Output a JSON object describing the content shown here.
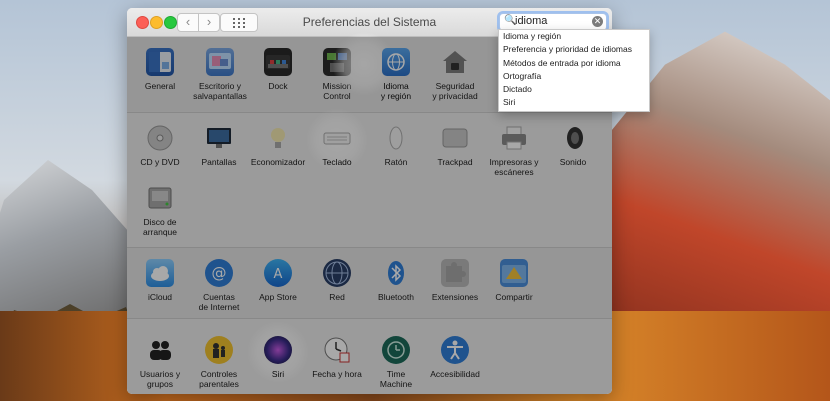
{
  "window": {
    "title": "Preferencias del Sistema",
    "back": "‹",
    "forward": "›"
  },
  "search": {
    "value": "idioma",
    "clear": "✕",
    "icon": "🔍",
    "results": [
      "Idioma y región",
      "Preferencia y prioridad de idiomas",
      "Métodos de entrada por idioma",
      "Ortografía",
      "Dictado",
      "Siri"
    ]
  },
  "prefs": {
    "general": "General",
    "escritorio": "Escritorio y\nsalvapantallas",
    "dock": "Dock",
    "mission": "Mission\nControl",
    "idioma": "Idioma\ny región",
    "seguridad": "Seguridad\ny privacidad",
    "cd": "CD y DVD",
    "pantallas": "Pantallas",
    "economizador": "Economizador",
    "teclado": "Teclado",
    "raton": "Ratón",
    "trackpad": "Trackpad",
    "impresoras": "Impresoras y\nescáneres",
    "sonido": "Sonido",
    "disco": "Disco de\narranque",
    "icloud": "iCloud",
    "cuentas": "Cuentas\nde Internet",
    "appstore": "App Store",
    "red": "Red",
    "bluetooth": "Bluetooth",
    "extensiones": "Extensiones",
    "compartir": "Compartir",
    "usuarios": "Usuarios y\ngrupos",
    "controles": "Controles\nparentales",
    "siri": "Siri",
    "fecha": "Fecha y hora",
    "timemachine": "Time\nMachine",
    "accesibilidad": "Accesibilidad"
  },
  "icons": {
    "general": "general-icon",
    "escritorio": "desktop-icon",
    "dock": "dock-icon",
    "mission": "mission-control-icon",
    "idioma": "globe-flag-icon",
    "seguridad": "house-lock-icon",
    "cd": "cd-icon",
    "pantallas": "display-icon",
    "economizador": "bulb-icon",
    "teclado": "keyboard-icon",
    "raton": "mouse-icon",
    "trackpad": "trackpad-icon",
    "impresoras": "printer-icon",
    "sonido": "speaker-icon",
    "disco": "disk-icon",
    "icloud": "cloud-icon",
    "cuentas": "at-icon",
    "appstore": "appstore-icon",
    "red": "network-globe-icon",
    "bluetooth": "bluetooth-icon",
    "extensiones": "puzzle-icon",
    "compartir": "sharing-icon",
    "usuarios": "users-icon",
    "controles": "parental-icon",
    "siri": "siri-icon",
    "fecha": "clock-icon",
    "timemachine": "time-machine-icon",
    "accesibilidad": "accessibility-icon"
  },
  "colors": {
    "search_focus": "#9fc0ee",
    "close": "#fc5f57",
    "minimize": "#fdbc2e",
    "maximize": "#28c840"
  }
}
